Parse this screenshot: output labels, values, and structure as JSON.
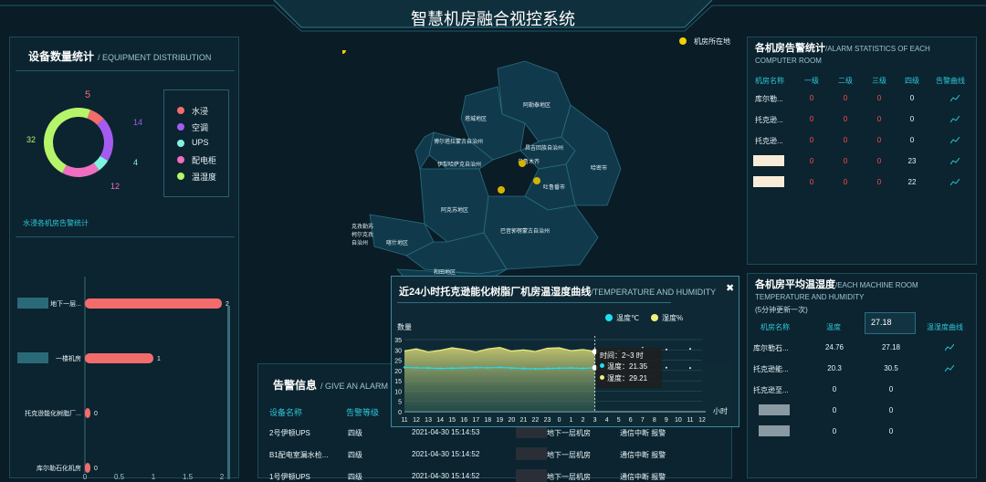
{
  "header": {
    "title": "智慧机房融合视控系统"
  },
  "map": {
    "legend_label": "机房所在地",
    "regions": [
      "阿勒泰地区",
      "塔城地区",
      "博尔塔拉蒙古自治州",
      "昌吉回族自治州",
      "伊犁哈萨克自治州",
      "乌鲁木齐",
      "哈密市",
      "吐鲁番市",
      "阿克苏地区",
      "巴音郭楞蒙古自治州",
      "克孜勒苏柯尔克孜自治州",
      "喀什地区",
      "和田地区"
    ]
  },
  "equipment": {
    "title": "设备数量统计",
    "title_en": "/ EQUIPMENT DISTRIBUTION",
    "colors": {
      "water": "#f36c6c",
      "ac": "#a45cf0",
      "ups": "#7ff4e0",
      "cabinet": "#f06ec0",
      "temp": "#b6f46a"
    },
    "legend": [
      "水浸",
      "空调",
      "UPS",
      "配电柜",
      "温湿度"
    ],
    "labels": {
      "a": "5",
      "b": "14",
      "c": "4",
      "d": "12",
      "e": "32"
    }
  },
  "chart_data": [
    {
      "type": "bar",
      "title": "水浸各机房告警统计",
      "categories": [
        "地下一层...",
        "一楼机房",
        "托克逊能化树脂厂...",
        "库尔勒石化机房"
      ],
      "values": [
        2,
        1,
        0,
        0
      ],
      "xticks": [
        "0",
        "0.5",
        "1",
        "1.5",
        "2"
      ],
      "xlim": [
        0,
        2
      ]
    },
    {
      "type": "line",
      "title": "近24小时托克逊能化树脂厂机房温湿度曲线",
      "title_en": "/TEMPERATURE AND HUMIDITY",
      "ylabel": "数量",
      "xlabel": "小时",
      "ylim": [
        0,
        35
      ],
      "yticks": [
        "0",
        "5",
        "10",
        "15",
        "20",
        "25",
        "30",
        "35"
      ],
      "categories": [
        "11",
        "12",
        "13",
        "14",
        "15",
        "16",
        "17",
        "18",
        "19",
        "20",
        "21",
        "22",
        "23",
        "0",
        "1",
        "2",
        "3",
        "4",
        "5",
        "6",
        "7",
        "8",
        "9",
        "10",
        "11",
        "12"
      ],
      "series": [
        {
          "name": "温度℃",
          "color": "#1ee0f0",
          "values": [
            21.5,
            21.3,
            21.2,
            21.0,
            21.1,
            21.2,
            21.4,
            21.3,
            21.5,
            21.2,
            21.0,
            20.8,
            21.0,
            21.1,
            21.2,
            21.0,
            21.35,
            21.3,
            21.2,
            21.0,
            21.1,
            21.2,
            21.4,
            21.3,
            21.2,
            21.1
          ]
        },
        {
          "name": "湿度%",
          "color": "#f0f07a",
          "values": [
            29.5,
            30.5,
            29.0,
            29.8,
            31.0,
            30.2,
            29.0,
            30.5,
            31.2,
            29.4,
            30.0,
            29.2,
            30.8,
            31.0,
            29.6,
            30.2,
            29.21,
            30.0,
            29.5,
            30.5,
            31.0,
            29.6,
            30.2,
            29.8,
            30.5,
            29.4
          ]
        }
      ]
    }
  ],
  "tooltip": {
    "time": "时间：2~3 时",
    "temp": "温度：21.35",
    "hum": "湿度：29.21"
  },
  "alarm_stats": {
    "title": "各机房告警统计",
    "title_en": "/ALARM STATISTICS OF EACH COMPUTER ROOM",
    "headers": [
      "机房名称",
      "一级",
      "二级",
      "三级",
      "四级",
      "告警曲线"
    ],
    "rows": [
      [
        "库尔勒...",
        "0",
        "0",
        "0",
        "0"
      ],
      [
        "托克逊...",
        "0",
        "0",
        "0",
        "0"
      ],
      [
        "托克逊...",
        "0",
        "0",
        "0",
        "0"
      ],
      [
        "",
        "0",
        "0",
        "0",
        "23"
      ],
      [
        "",
        "0",
        "0",
        "0",
        "22"
      ]
    ]
  },
  "avg_temp": {
    "title": "各机房平均温湿度",
    "title_en": "/EACH MACHINE ROOM TEMPERATURE AND HUMIDITY",
    "note": "(5分钟更新一次)",
    "headers": [
      "机房名称",
      "温度",
      "湿度",
      "温湿度曲线"
    ],
    "popup": "27.18",
    "rows": [
      [
        "库尔勒石...",
        "24.76",
        "27.18"
      ],
      [
        "托克逊能...",
        "20.3",
        "30.5"
      ],
      [
        "托克逊至...",
        "0",
        "0"
      ],
      [
        "",
        "0",
        "0"
      ],
      [
        "",
        "0",
        "0"
      ]
    ]
  },
  "alarm_info": {
    "title": "告警信息",
    "title_en": "/ GIVE AN ALARM",
    "headers": [
      "设备名称",
      "告警等级"
    ],
    "rows": [
      [
        "2号伊顿UPS",
        "四级",
        "2021-04-30 15:14:53",
        "地下一层机房",
        "通信中断 报警"
      ],
      [
        "B1配电室漏水检...",
        "四级",
        "2021-04-30 15:14:52",
        "地下一层机房",
        "通信中断 报警"
      ],
      [
        "1号伊顿UPS",
        "四级",
        "2021-04-30 15:14:52",
        "地下一层机房",
        "通信中断 报警"
      ]
    ]
  }
}
